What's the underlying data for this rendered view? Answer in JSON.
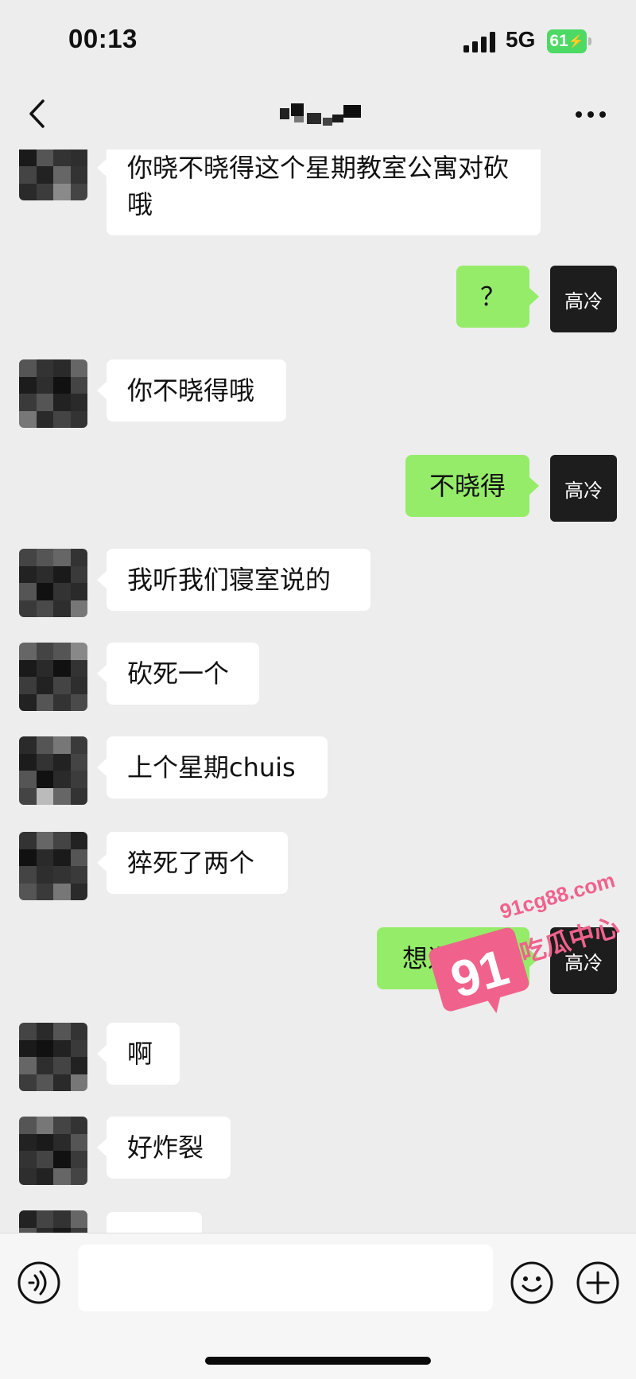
{
  "status_bar": {
    "time": "00:13",
    "network": "5G",
    "battery": "61",
    "battery_color": "#4cd964"
  },
  "nav_bar": {
    "back_icon": "chevron-left-icon",
    "more_icon": "ellipsis-icon"
  },
  "self_avatar_label": "高冷",
  "messages": [
    {
      "side": "in",
      "text": "你晓不晓得这个星期教室公寓对砍哦"
    },
    {
      "side": "out",
      "text": "？"
    },
    {
      "side": "in",
      "text": "你不晓得哦"
    },
    {
      "side": "out",
      "text": "不晓得"
    },
    {
      "side": "in",
      "text": "我听我们寝室说的"
    },
    {
      "side": "in",
      "text": "砍死一个"
    },
    {
      "side": "in",
      "text": "上个星期chuis"
    },
    {
      "side": "in",
      "text": "猝死了两个"
    },
    {
      "side": "out",
      "text": "想退学了"
    },
    {
      "side": "in",
      "text": "啊"
    },
    {
      "side": "in",
      "text": "好炸裂"
    }
  ],
  "watermark": {
    "site": "91cg88.com",
    "number": "91",
    "brand": "吃瓜中心",
    "color": "#f0628c"
  },
  "input_bar": {
    "voice_icon": "voice-icon",
    "emoji_icon": "emoji-icon",
    "plus_icon": "plus-icon"
  },
  "colors": {
    "background": "#ededed",
    "outgoing_bubble": "#95ec69",
    "incoming_bubble": "#ffffff"
  }
}
